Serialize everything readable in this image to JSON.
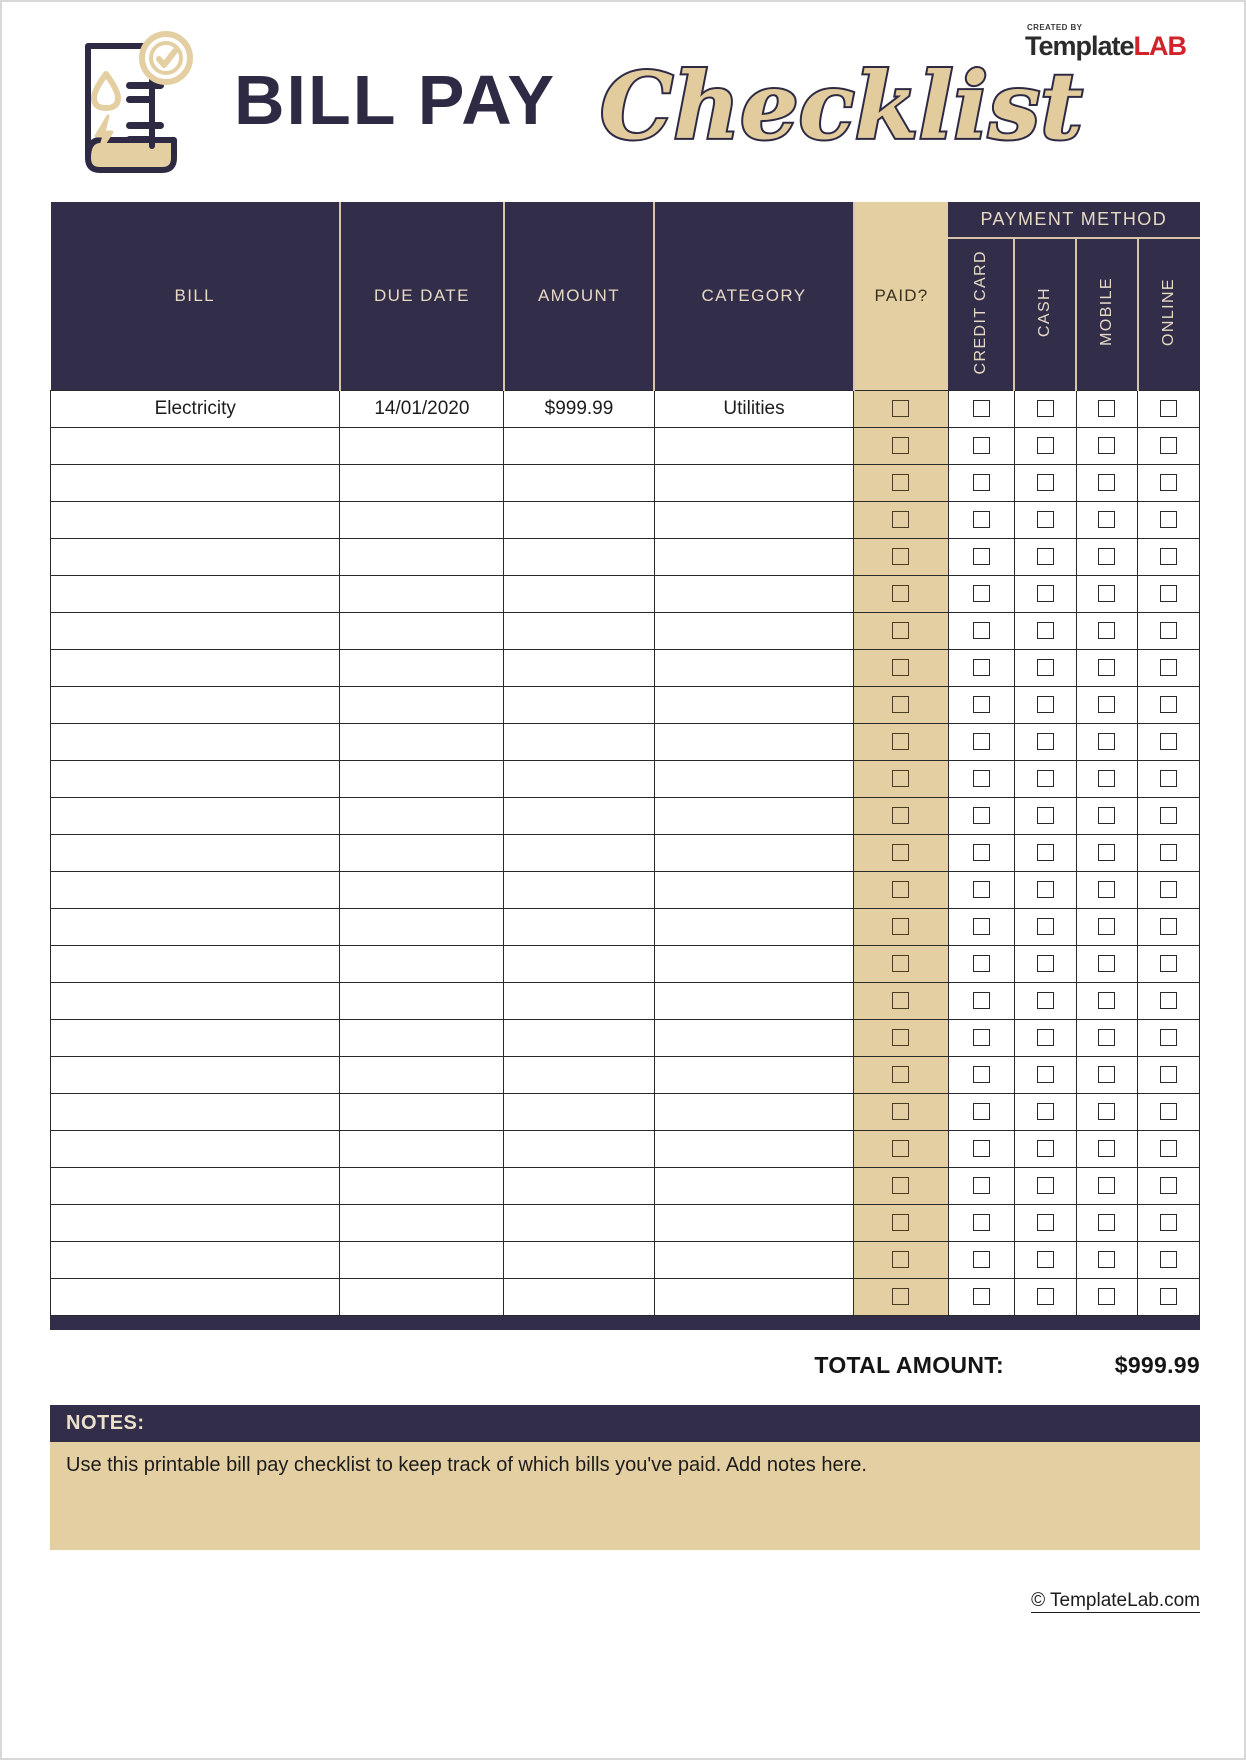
{
  "document": {
    "title_primary": "BILL PAY",
    "title_script": "Checklist"
  },
  "brand": {
    "created_by": "CREATED BY",
    "name_dark": "Template",
    "name_accent": "LAB",
    "accent_color": "#d1232a"
  },
  "icons": {
    "bill_document": "bill-document-icon",
    "check_badge": "check-badge-icon",
    "water_drop": "water-drop-icon",
    "lightning_bolt": "lightning-bolt-icon"
  },
  "colors": {
    "navy": "#322e4a",
    "tan": "#e4cfa3",
    "tan_light": "#e6d8c3",
    "ink": "#1c1c1c"
  },
  "table": {
    "columns": [
      {
        "key": "bill",
        "label": "BILL"
      },
      {
        "key": "due_date",
        "label": "DUE DATE"
      },
      {
        "key": "amount",
        "label": "AMOUNT"
      },
      {
        "key": "category",
        "label": "CATEGORY"
      },
      {
        "key": "paid",
        "label": "PAID?"
      }
    ],
    "payment_method_group": "PAYMENT METHOD",
    "payment_methods": [
      "CREDIT CARD",
      "CASH",
      "MOBILE",
      "ONLINE"
    ],
    "row_count": 25,
    "rows": [
      {
        "bill": "Electricity",
        "due_date": "14/01/2020",
        "amount": "$999.99",
        "category": "Utilities",
        "paid": false,
        "methods": [
          false,
          false,
          false,
          false
        ]
      },
      {
        "bill": "",
        "due_date": "",
        "amount": "",
        "category": "",
        "paid": false,
        "methods": [
          false,
          false,
          false,
          false
        ]
      },
      {
        "bill": "",
        "due_date": "",
        "amount": "",
        "category": "",
        "paid": false,
        "methods": [
          false,
          false,
          false,
          false
        ]
      },
      {
        "bill": "",
        "due_date": "",
        "amount": "",
        "category": "",
        "paid": false,
        "methods": [
          false,
          false,
          false,
          false
        ]
      },
      {
        "bill": "",
        "due_date": "",
        "amount": "",
        "category": "",
        "paid": false,
        "methods": [
          false,
          false,
          false,
          false
        ]
      },
      {
        "bill": "",
        "due_date": "",
        "amount": "",
        "category": "",
        "paid": false,
        "methods": [
          false,
          false,
          false,
          false
        ]
      },
      {
        "bill": "",
        "due_date": "",
        "amount": "",
        "category": "",
        "paid": false,
        "methods": [
          false,
          false,
          false,
          false
        ]
      },
      {
        "bill": "",
        "due_date": "",
        "amount": "",
        "category": "",
        "paid": false,
        "methods": [
          false,
          false,
          false,
          false
        ]
      },
      {
        "bill": "",
        "due_date": "",
        "amount": "",
        "category": "",
        "paid": false,
        "methods": [
          false,
          false,
          false,
          false
        ]
      },
      {
        "bill": "",
        "due_date": "",
        "amount": "",
        "category": "",
        "paid": false,
        "methods": [
          false,
          false,
          false,
          false
        ]
      },
      {
        "bill": "",
        "due_date": "",
        "amount": "",
        "category": "",
        "paid": false,
        "methods": [
          false,
          false,
          false,
          false
        ]
      },
      {
        "bill": "",
        "due_date": "",
        "amount": "",
        "category": "",
        "paid": false,
        "methods": [
          false,
          false,
          false,
          false
        ]
      },
      {
        "bill": "",
        "due_date": "",
        "amount": "",
        "category": "",
        "paid": false,
        "methods": [
          false,
          false,
          false,
          false
        ]
      },
      {
        "bill": "",
        "due_date": "",
        "amount": "",
        "category": "",
        "paid": false,
        "methods": [
          false,
          false,
          false,
          false
        ]
      },
      {
        "bill": "",
        "due_date": "",
        "amount": "",
        "category": "",
        "paid": false,
        "methods": [
          false,
          false,
          false,
          false
        ]
      },
      {
        "bill": "",
        "due_date": "",
        "amount": "",
        "category": "",
        "paid": false,
        "methods": [
          false,
          false,
          false,
          false
        ]
      },
      {
        "bill": "",
        "due_date": "",
        "amount": "",
        "category": "",
        "paid": false,
        "methods": [
          false,
          false,
          false,
          false
        ]
      },
      {
        "bill": "",
        "due_date": "",
        "amount": "",
        "category": "",
        "paid": false,
        "methods": [
          false,
          false,
          false,
          false
        ]
      },
      {
        "bill": "",
        "due_date": "",
        "amount": "",
        "category": "",
        "paid": false,
        "methods": [
          false,
          false,
          false,
          false
        ]
      },
      {
        "bill": "",
        "due_date": "",
        "amount": "",
        "category": "",
        "paid": false,
        "methods": [
          false,
          false,
          false,
          false
        ]
      },
      {
        "bill": "",
        "due_date": "",
        "amount": "",
        "category": "",
        "paid": false,
        "methods": [
          false,
          false,
          false,
          false
        ]
      },
      {
        "bill": "",
        "due_date": "",
        "amount": "",
        "category": "",
        "paid": false,
        "methods": [
          false,
          false,
          false,
          false
        ]
      },
      {
        "bill": "",
        "due_date": "",
        "amount": "",
        "category": "",
        "paid": false,
        "methods": [
          false,
          false,
          false,
          false
        ]
      },
      {
        "bill": "",
        "due_date": "",
        "amount": "",
        "category": "",
        "paid": false,
        "methods": [
          false,
          false,
          false,
          false
        ]
      },
      {
        "bill": "",
        "due_date": "",
        "amount": "",
        "category": "",
        "paid": false,
        "methods": [
          false,
          false,
          false,
          false
        ]
      }
    ]
  },
  "total": {
    "label": "TOTAL AMOUNT:",
    "value": "$999.99"
  },
  "notes": {
    "header": "NOTES:",
    "text": "Use this printable bill pay checklist to keep track of which bills you've paid. Add notes here."
  },
  "footer": {
    "copyright": "© TemplateLab.com"
  }
}
